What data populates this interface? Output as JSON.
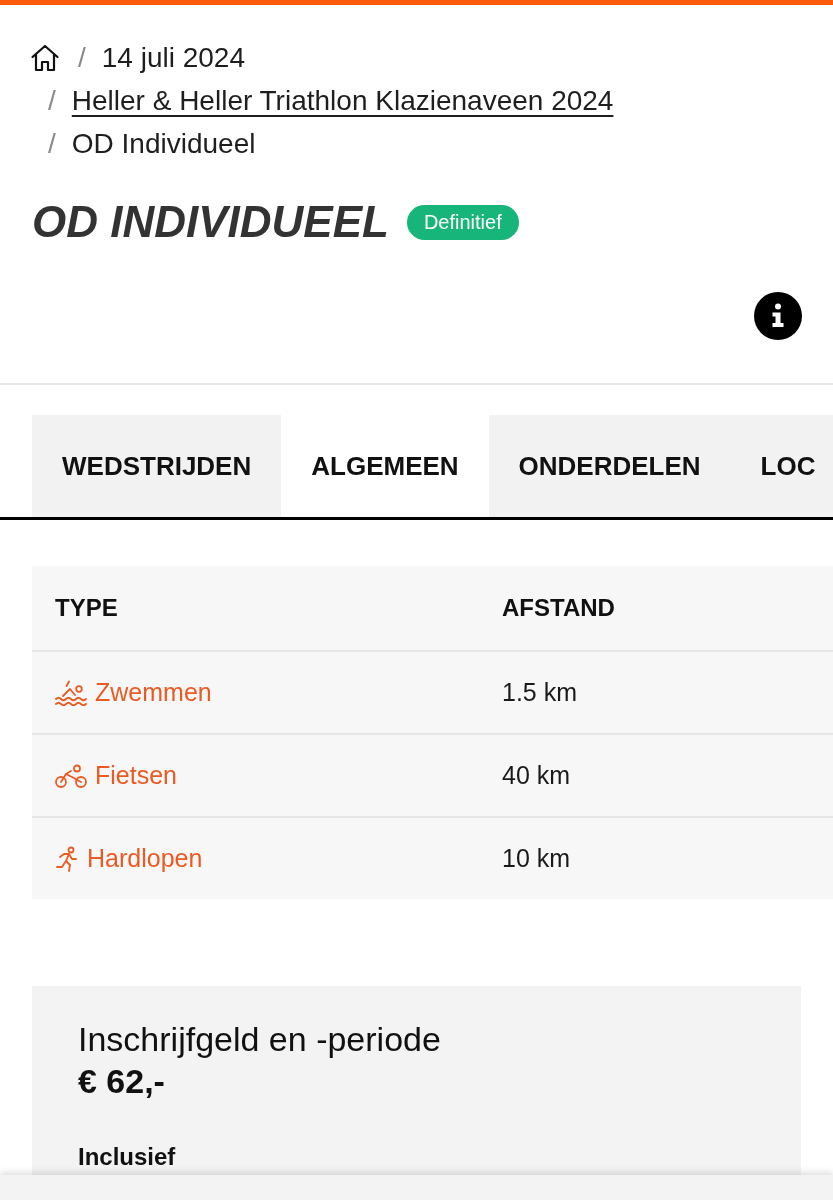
{
  "breadcrumb": [
    {
      "separator": "/",
      "label": "14 juli 2024",
      "link": false
    },
    {
      "separator": "/",
      "label": "Heller & Heller Triathlon Klazienaveen 2024",
      "link": true
    },
    {
      "separator": "/",
      "label": "OD Individueel",
      "link": false
    }
  ],
  "title": "OD INDIVIDUEEL",
  "status_badge": "Definitief",
  "tabs": [
    {
      "label": "WEDSTRIJDEN",
      "selected": false
    },
    {
      "label": "ALGEMEEN",
      "selected": true
    },
    {
      "label": "ONDERDELEN",
      "selected": false
    },
    {
      "label": "LOC",
      "selected": false
    }
  ],
  "table": {
    "columns": [
      "TYPE",
      "AFSTAND"
    ],
    "rows": [
      {
        "kind": "swim",
        "type": "Zwemmen",
        "distance": "1.5 km"
      },
      {
        "kind": "bike",
        "type": "Fietsen",
        "distance": "40 km"
      },
      {
        "kind": "run",
        "type": "Hardlopen",
        "distance": "10 km"
      }
    ]
  },
  "fee_card": {
    "title": "Inschrijfgeld en -periode",
    "price": "€ 62,-",
    "section": "Inclusief"
  }
}
